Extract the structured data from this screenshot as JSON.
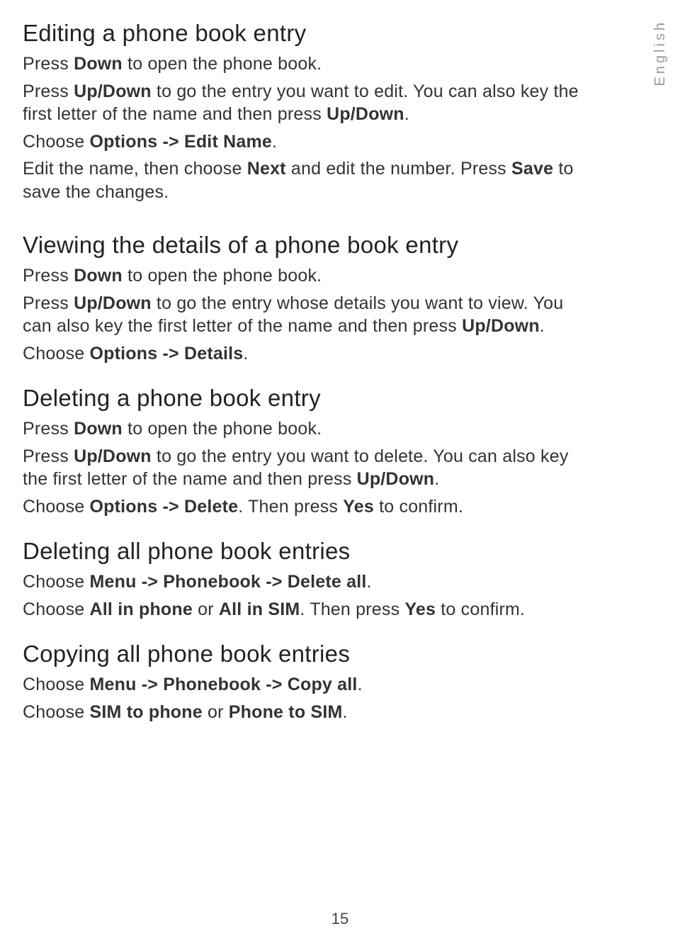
{
  "language_tab": "English",
  "page_number": "15",
  "sections": {
    "editing": {
      "heading": "Editing a phone book entry",
      "p1_pre": "Press ",
      "p1_b1": "Down",
      "p1_post": " to open the phone book.",
      "p2_pre": "Press ",
      "p2_b1": "Up/Down",
      "p2_mid": " to go the entry you want to edit. You can also key the first letter of the name and then press ",
      "p2_b2": "Up/Down",
      "p2_post": ".",
      "p3_pre": "Choose ",
      "p3_b1": "Options -> Edit Name",
      "p3_post": ".",
      "p4_pre": "Edit the name, then choose ",
      "p4_b1": "Next",
      "p4_mid": " and edit the number. Press ",
      "p4_b2": "Save",
      "p4_post": " to save the changes."
    },
    "viewing": {
      "heading": "Viewing the details of a phone book entry",
      "p1_pre": "Press ",
      "p1_b1": "Down",
      "p1_post": " to open the phone book.",
      "p2_pre": "Press ",
      "p2_b1": "Up/Down",
      "p2_mid": " to go the entry whose details you want to view. You can also key the first letter of the name and then press ",
      "p2_b2": "Up/Down",
      "p2_post": ".",
      "p3_pre": "Choose ",
      "p3_b1": "Options -> Details",
      "p3_post": "."
    },
    "deleting": {
      "heading": "Deleting a phone book entry",
      "p1_pre": "Press ",
      "p1_b1": "Down",
      "p1_post": " to open the phone book.",
      "p2_pre": "Press ",
      "p2_b1": "Up/Down",
      "p2_mid": " to go the entry you want to delete. You can also key the first letter of the name and then press ",
      "p2_b2": "Up/Down",
      "p2_post": ".",
      "p3_pre": "Choose ",
      "p3_b1": "Options -> Delete",
      "p3_mid": ". Then press ",
      "p3_b2": "Yes",
      "p3_post": " to confirm."
    },
    "deleting_all": {
      "heading": "Deleting all phone book entries",
      "p1_pre": "Choose ",
      "p1_b1": "Menu -> Phonebook -> Delete all",
      "p1_post": ".",
      "p2_pre": "Choose ",
      "p2_b1": "All in phone",
      "p2_mid1": " or ",
      "p2_b2": "All in SIM",
      "p2_mid2": ". Then press ",
      "p2_b3": "Yes",
      "p2_post": " to confirm."
    },
    "copying_all": {
      "heading": "Copying all phone book entries",
      "p1_pre": "Choose ",
      "p1_b1": "Menu -> Phonebook -> Copy all",
      "p1_post": ".",
      "p2_pre": "Choose ",
      "p2_b1": "SIM to phone",
      "p2_mid": " or ",
      "p2_b2": "Phone to SIM",
      "p2_post": "."
    }
  }
}
